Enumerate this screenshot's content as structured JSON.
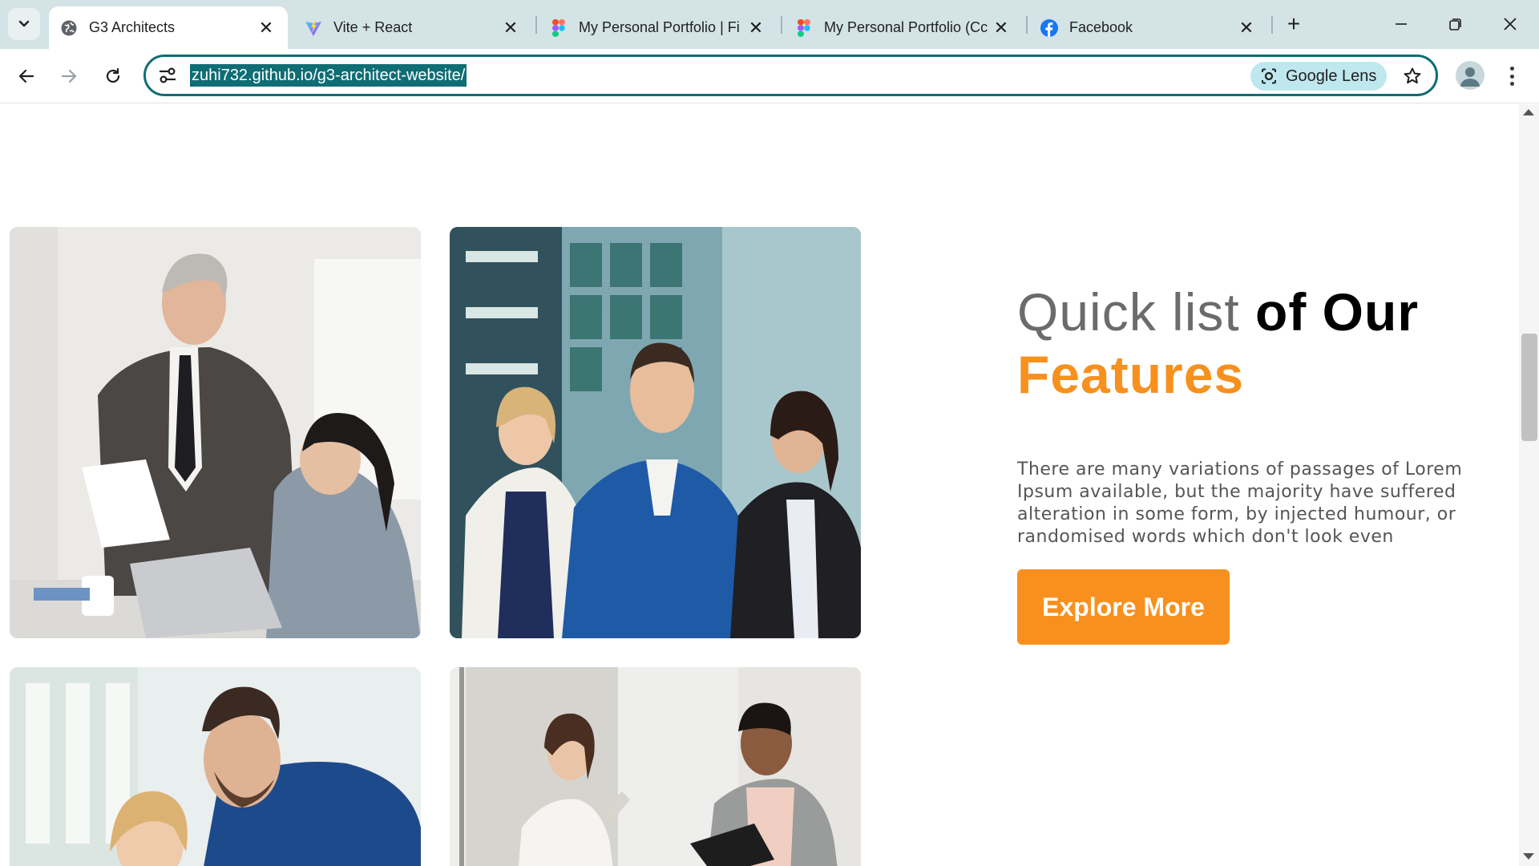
{
  "browser": {
    "tabs": [
      {
        "title": "G3 Architects",
        "icon": "globe-icon",
        "active": true
      },
      {
        "title": "Vite + React",
        "icon": "vite-icon",
        "active": false
      },
      {
        "title": "My Personal Portfolio | Fi",
        "icon": "figma-icon",
        "active": false
      },
      {
        "title": "My Personal Portfolio (Cc",
        "icon": "figma-icon",
        "active": false
      },
      {
        "title": "Facebook",
        "icon": "facebook-icon",
        "active": false
      }
    ],
    "tab_close_glyph": "✕",
    "new_tab_glyph": "+",
    "url": "zuhi732.github.io/g3-architect-website/",
    "lens_label": "Google Lens",
    "accent": "#0f6d74"
  },
  "page": {
    "heading_light": "Quick list ",
    "heading_bold": "of Our",
    "heading_accent": "Features",
    "description": "There are many variations of passages of Lorem Ipsum available, but the majority have suffered alteration in some form, by injected humour, or randomised words which don't look even",
    "cta_label": "Explore More",
    "accent_color": "#f7901e",
    "photos": [
      {
        "subject": "office-meeting-photo"
      },
      {
        "subject": "business-team-photo"
      },
      {
        "subject": "team-discussion-photo"
      },
      {
        "subject": "colleagues-talking-photo"
      }
    ]
  }
}
